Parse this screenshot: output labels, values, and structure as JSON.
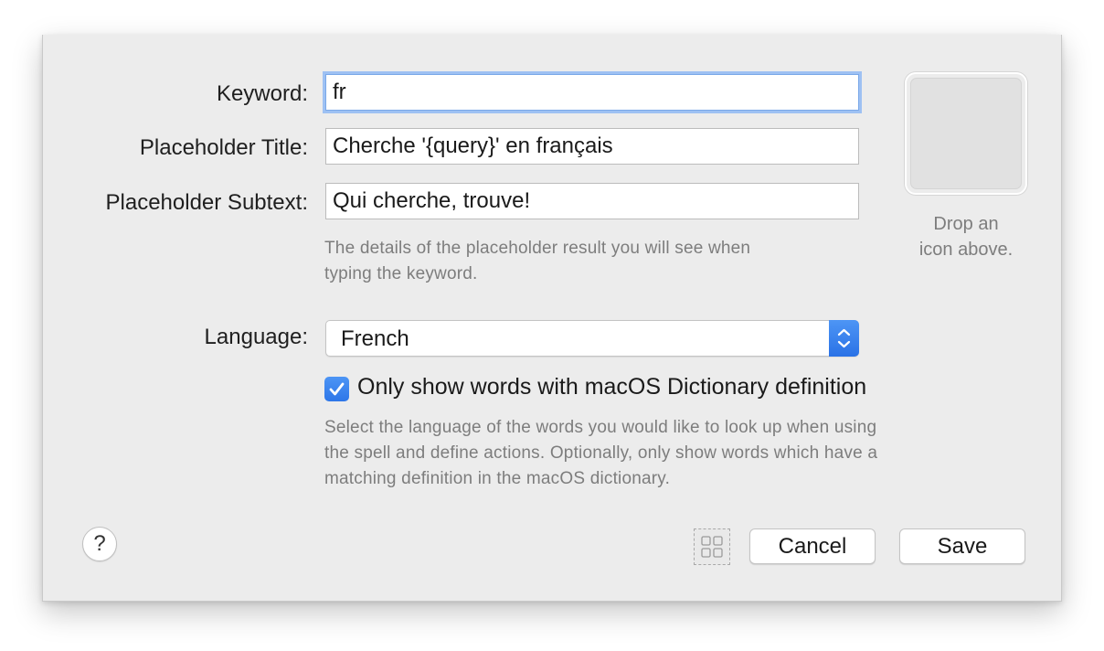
{
  "form": {
    "keyword_label": "Keyword:",
    "keyword_value": "fr",
    "placeholder_title_label": "Placeholder Title:",
    "placeholder_title_value": "Cherche '{query}' en français",
    "placeholder_subtext_label": "Placeholder Subtext:",
    "placeholder_subtext_value": "Qui cherche, trouve!",
    "placeholder_hint_line1": "The details of the placeholder result you will see when",
    "placeholder_hint_line2": "typing the keyword.",
    "language_label": "Language:",
    "language_value": "French",
    "dictionary_checkbox_label": "Only show words with macOS Dictionary definition",
    "dictionary_checked": true,
    "language_hint_line1": "Select the language of the words you would like to look up when using",
    "language_hint_line2": "the spell and define actions. Optionally, only show words which have a",
    "language_hint_line3": "matching definition in the macOS dictionary."
  },
  "icon_well": {
    "drop_text_line1": "Drop an",
    "drop_text_line2": "icon above."
  },
  "footer": {
    "help_label": "?",
    "cancel_label": "Cancel",
    "save_label": "Save"
  },
  "colors": {
    "accent": "#2f7bea",
    "focus_ring": "#9ec1f3",
    "sheet_background": "#ececec",
    "hint_text": "#7d7d7d"
  },
  "icons": [
    "chevron-up-down-icon",
    "checkmark-icon",
    "grid-icon",
    "help-icon"
  ]
}
